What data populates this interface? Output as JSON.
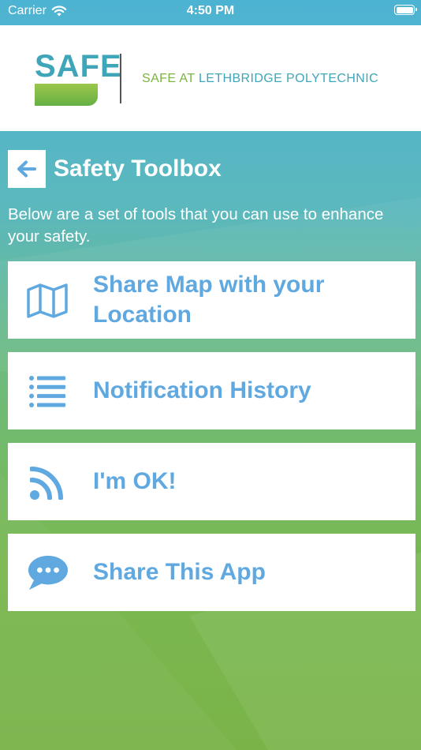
{
  "status_bar": {
    "carrier": "Carrier",
    "time": "4:50 PM"
  },
  "header": {
    "logo_text": "SAFE",
    "tagline_accent": "SAFE AT",
    "tagline_rest": " LETHBRIDGE POLYTECHNIC"
  },
  "page": {
    "title": "Safety Toolbox",
    "description": "Below are a set of tools that you can use to enhance your safety."
  },
  "tools": [
    {
      "label": "Share Map with your Location",
      "icon": "map-icon"
    },
    {
      "label": "Notification History",
      "icon": "list-icon"
    },
    {
      "label": "I'm OK!",
      "icon": "rss-icon"
    },
    {
      "label": "Share This App",
      "icon": "chat-bubble-icon"
    }
  ],
  "colors": {
    "accent_blue": "#5fa8e0",
    "logo_teal": "#3fa6b9",
    "logo_green": "#7cb342"
  }
}
